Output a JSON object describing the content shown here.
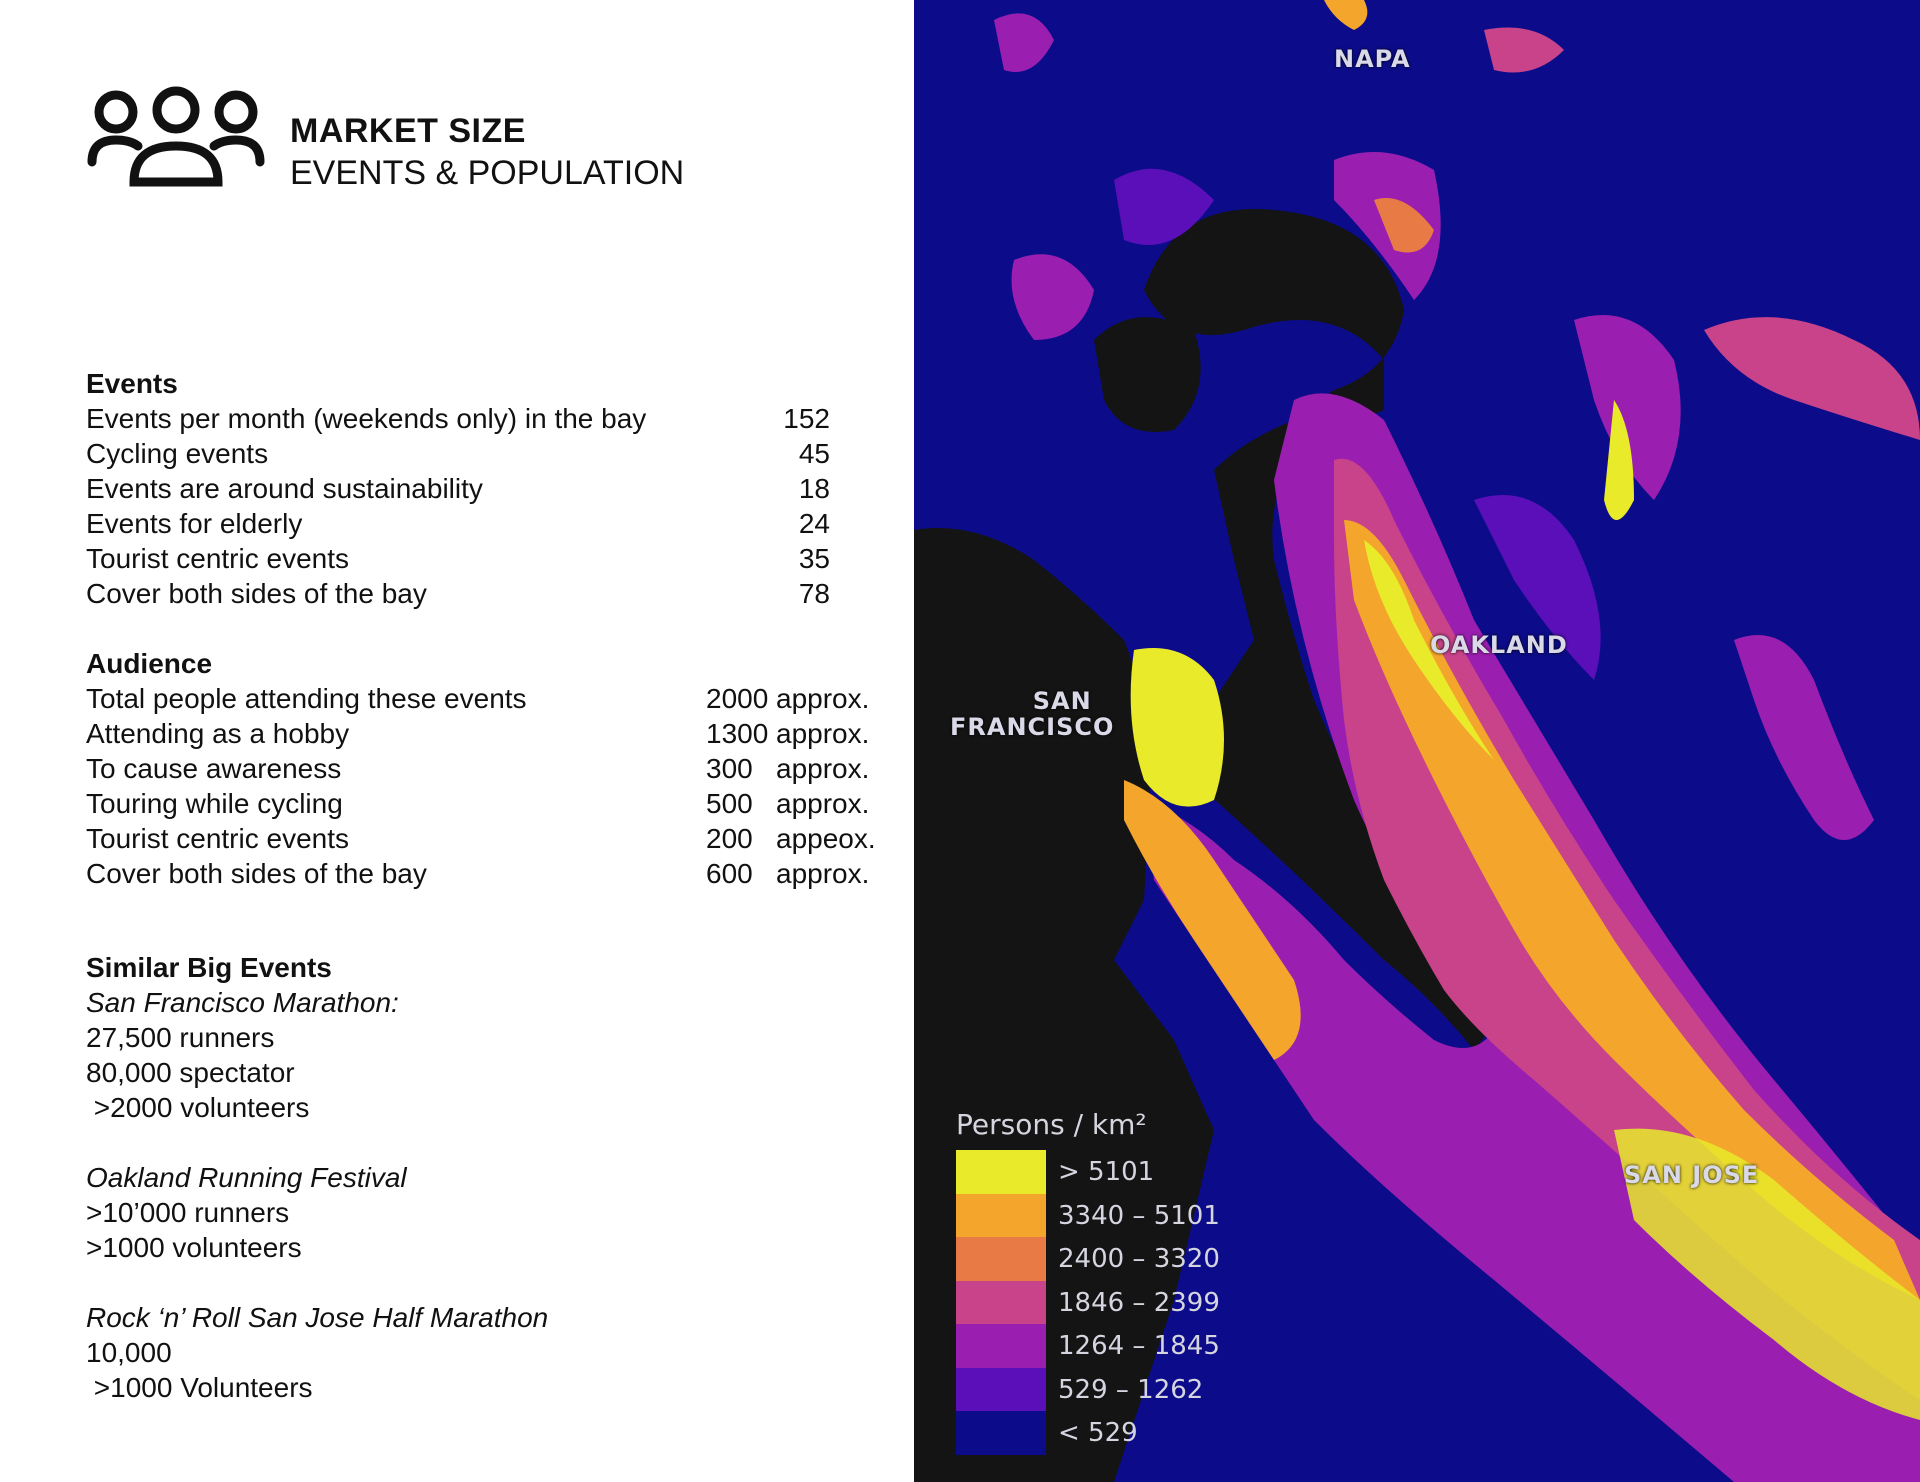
{
  "header": {
    "icon": "group-of-people-icon",
    "title": "MARKET SIZE",
    "subtitle": "EVENTS & POPULATION"
  },
  "events": {
    "heading": "Events",
    "rows": [
      {
        "label": "Events per month (weekends only) in the bay",
        "value": "152"
      },
      {
        "label": "Cycling events",
        "value": "45"
      },
      {
        "label": "Events are around sustainability",
        "value": "18"
      },
      {
        "label": "Events for elderly",
        "value": "24"
      },
      {
        "label": "Tourist centric events",
        "value": "35"
      },
      {
        "label": "Cover both sides of the bay",
        "value": "78"
      }
    ]
  },
  "audience": {
    "heading": "Audience",
    "rows": [
      {
        "label": "Total people attending these events",
        "value": "2000",
        "unit": "approx."
      },
      {
        "label": "Attending as a hobby",
        "value": "1300",
        "unit": "approx."
      },
      {
        "label": "To cause awareness",
        "value": "300",
        "unit": "approx."
      },
      {
        "label": "Touring while cycling",
        "value": "500",
        "unit": "approx."
      },
      {
        "label": "Tourist centric events",
        "value": "200",
        "unit": "appeox."
      },
      {
        "label": "Cover both sides of the bay",
        "value": "600",
        "unit": "approx."
      }
    ]
  },
  "similar": {
    "heading": "Similar Big Events",
    "items": [
      {
        "name": "San Francisco Marathon:",
        "lines": [
          "27,500 runners",
          "80,000 spectator",
          " >2000 volunteers"
        ]
      },
      {
        "name": "Oakland Running Festival",
        "lines": [
          ">10’000 runners",
          ">1000 volunteers"
        ]
      },
      {
        "name": "Rock ‘n’ Roll San Jose Half Marathon",
        "lines": [
          "10,000",
          " >1000 Volunteers"
        ]
      }
    ]
  },
  "map": {
    "cities": {
      "napa": "NAPA",
      "oakland": "OAKLAND",
      "sf_line1": "SAN",
      "sf_line2": "FRANCISCO",
      "san_jose": "SAN JOSE"
    },
    "legend": {
      "title": "Persons / km²",
      "entries": [
        {
          "label": "> 5101",
          "color": "#e8ea2a"
        },
        {
          "label": "3340 – 5101",
          "color": "#f4a52c"
        },
        {
          "label": "2400 – 3320",
          "color": "#e87a45"
        },
        {
          "label": "1846 – 2399",
          "color": "#c8438a"
        },
        {
          "label": "1264 – 1845",
          "color": "#9a1fb0"
        },
        {
          "label": "529 – 1262",
          "color": "#5a0fb8"
        },
        {
          "label": "< 529",
          "color": "#0c0c8a"
        }
      ]
    },
    "colors": {
      "water": "#141414",
      "low": "#0c0c8a"
    }
  }
}
